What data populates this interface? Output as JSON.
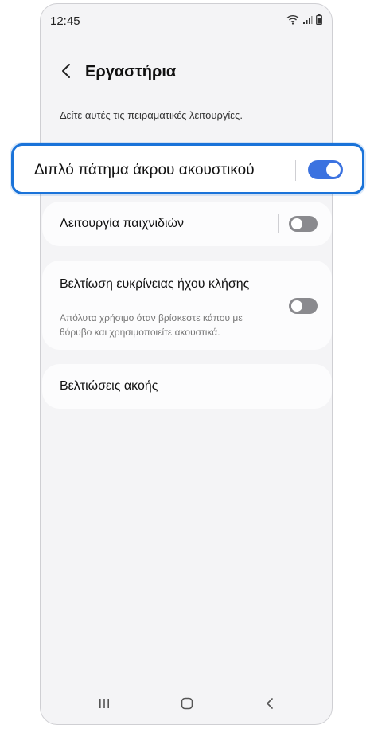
{
  "status_bar": {
    "time": "12:45",
    "icons": [
      "wifi-icon",
      "signal-icon",
      "battery-icon"
    ]
  },
  "header": {
    "back_icon": "chevron-left-icon",
    "title": "Εργαστήρια"
  },
  "description": "Δείτε αυτές τις πειραματικές λειτουργίες.",
  "highlight": {
    "label": "Διπλό πάτημα άκρου ακουστικού",
    "toggle_on": true,
    "accent_color": "#1a73d9"
  },
  "settings": {
    "game_mode": {
      "label": "Λειτουργία παιχνιδιών",
      "toggle_on": false
    },
    "call_clarity": {
      "label": "Βελτίωση ευκρίνειας ήχου κλήσης",
      "sublabel": "Απόλυτα χρήσιμο όταν βρίσκεστε κάπου με θόρυβο και χρησιμοποιείτε ακουστικά.",
      "toggle_on": false
    },
    "hearing": {
      "label": "Βελτιώσεις ακοής"
    }
  },
  "nav_bar": {
    "icons": [
      "recent-apps-icon",
      "home-icon",
      "back-icon"
    ]
  }
}
